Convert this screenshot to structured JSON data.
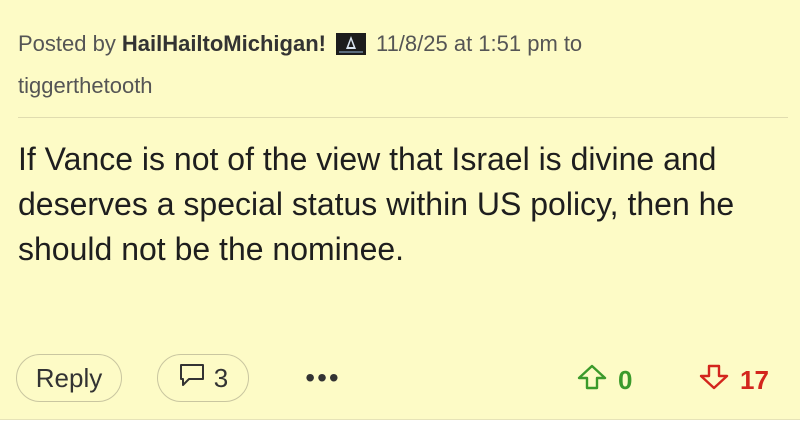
{
  "post": {
    "posted_by_prefix": "Posted by",
    "username": "HailHailtoMichigan!",
    "timestamp": "11/8/25 at 1:51 pm",
    "to_word": "to",
    "reply_to_user": "tiggerthetooth",
    "body": "If Vance is not of the view that Israel is divine and deserves a special status within US policy, then he should not be the nominee."
  },
  "actions": {
    "reply_label": "Reply",
    "comment_count": "3",
    "more_label": "•••",
    "upvotes": "0",
    "downvotes": "17"
  },
  "colors": {
    "card_background": "#fdfbc6",
    "upvote": "#3b9a2b",
    "downvote": "#d3261d",
    "text": "#1e1e1e"
  },
  "icons": {
    "badge": "user-badge-icon",
    "comment": "comment-bubble-icon",
    "upvote": "arrow-up-icon",
    "downvote": "arrow-down-icon"
  }
}
